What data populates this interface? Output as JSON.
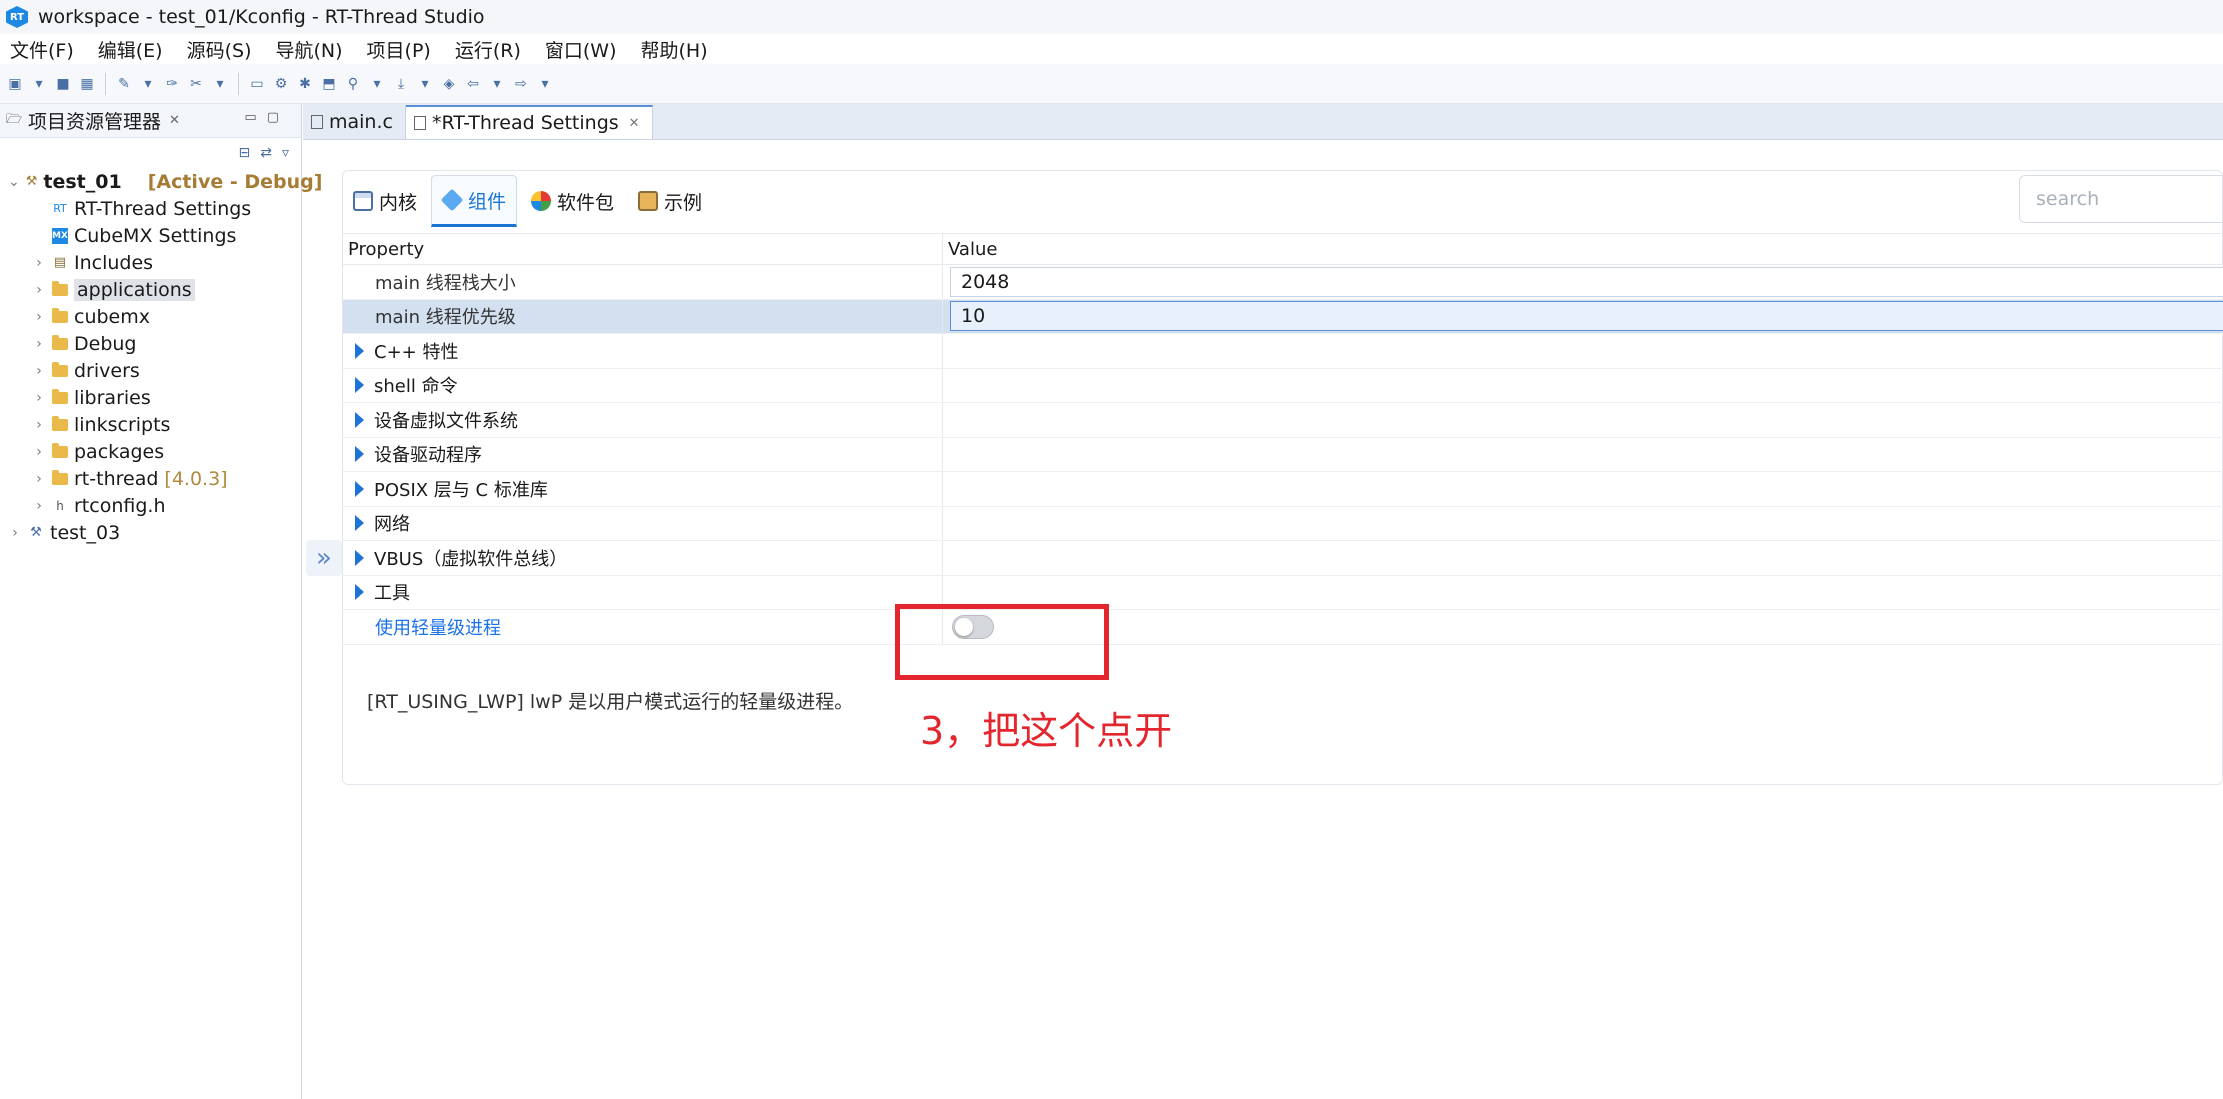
{
  "window": {
    "title": "workspace - test_01/Kconfig - RT-Thread Studio",
    "logo_text": "RT"
  },
  "menu": [
    "文件(F)",
    "编辑(E)",
    "源码(S)",
    "导航(N)",
    "项目(P)",
    "运行(R)",
    "窗口(W)",
    "帮助(H)"
  ],
  "project_explorer": {
    "title": "项目资源管理器",
    "close_glyph": "✕",
    "tree": [
      {
        "label": "test_01",
        "decoration": "[Active - Debug]",
        "expanded": true
      },
      {
        "label": "RT-Thread Settings"
      },
      {
        "label": "CubeMX Settings",
        "badge": "MX"
      },
      {
        "label": "Includes"
      },
      {
        "label": "applications",
        "selected": true
      },
      {
        "label": "cubemx"
      },
      {
        "label": "Debug"
      },
      {
        "label": "drivers"
      },
      {
        "label": "libraries"
      },
      {
        "label": "linkscripts"
      },
      {
        "label": "packages"
      },
      {
        "label": "rt-thread",
        "version": "[4.0.3]"
      },
      {
        "label": "rtconfig.h"
      },
      {
        "label": "test_03"
      }
    ]
  },
  "side_toggle_glyph": "»",
  "editor_tabs": [
    {
      "label": "main.c"
    },
    {
      "label": "*RT-Thread Settings",
      "active": true,
      "close_glyph": "✕"
    }
  ],
  "category_tabs": [
    {
      "label": "内核"
    },
    {
      "label": "组件",
      "active": true
    },
    {
      "label": "软件包"
    },
    {
      "label": "示例"
    }
  ],
  "search": {
    "placeholder": "search"
  },
  "grid": {
    "headers": {
      "property": "Property",
      "value": "Value"
    },
    "rows": [
      {
        "label": "main 线程栈大小",
        "value": "2048"
      },
      {
        "label": "main 线程优先级",
        "value": "10",
        "selected": true
      },
      {
        "label": "C++ 特性"
      },
      {
        "label": "shell 命令"
      },
      {
        "label": "设备虚拟文件系统"
      },
      {
        "label": "设备驱动程序"
      },
      {
        "label": "POSIX 层与 C 标准库"
      },
      {
        "label": "网络"
      },
      {
        "label": "VBUS（虚拟软件总线）"
      },
      {
        "label": "工具"
      },
      {
        "label": "使用轻量级进程",
        "toggle": false
      }
    ],
    "description": "[RT_USING_LWP] lwP 是以用户模式运行的轻量级进程。"
  },
  "annotation": {
    "text": "3，把这个点开",
    "color": "#e3262d"
  }
}
